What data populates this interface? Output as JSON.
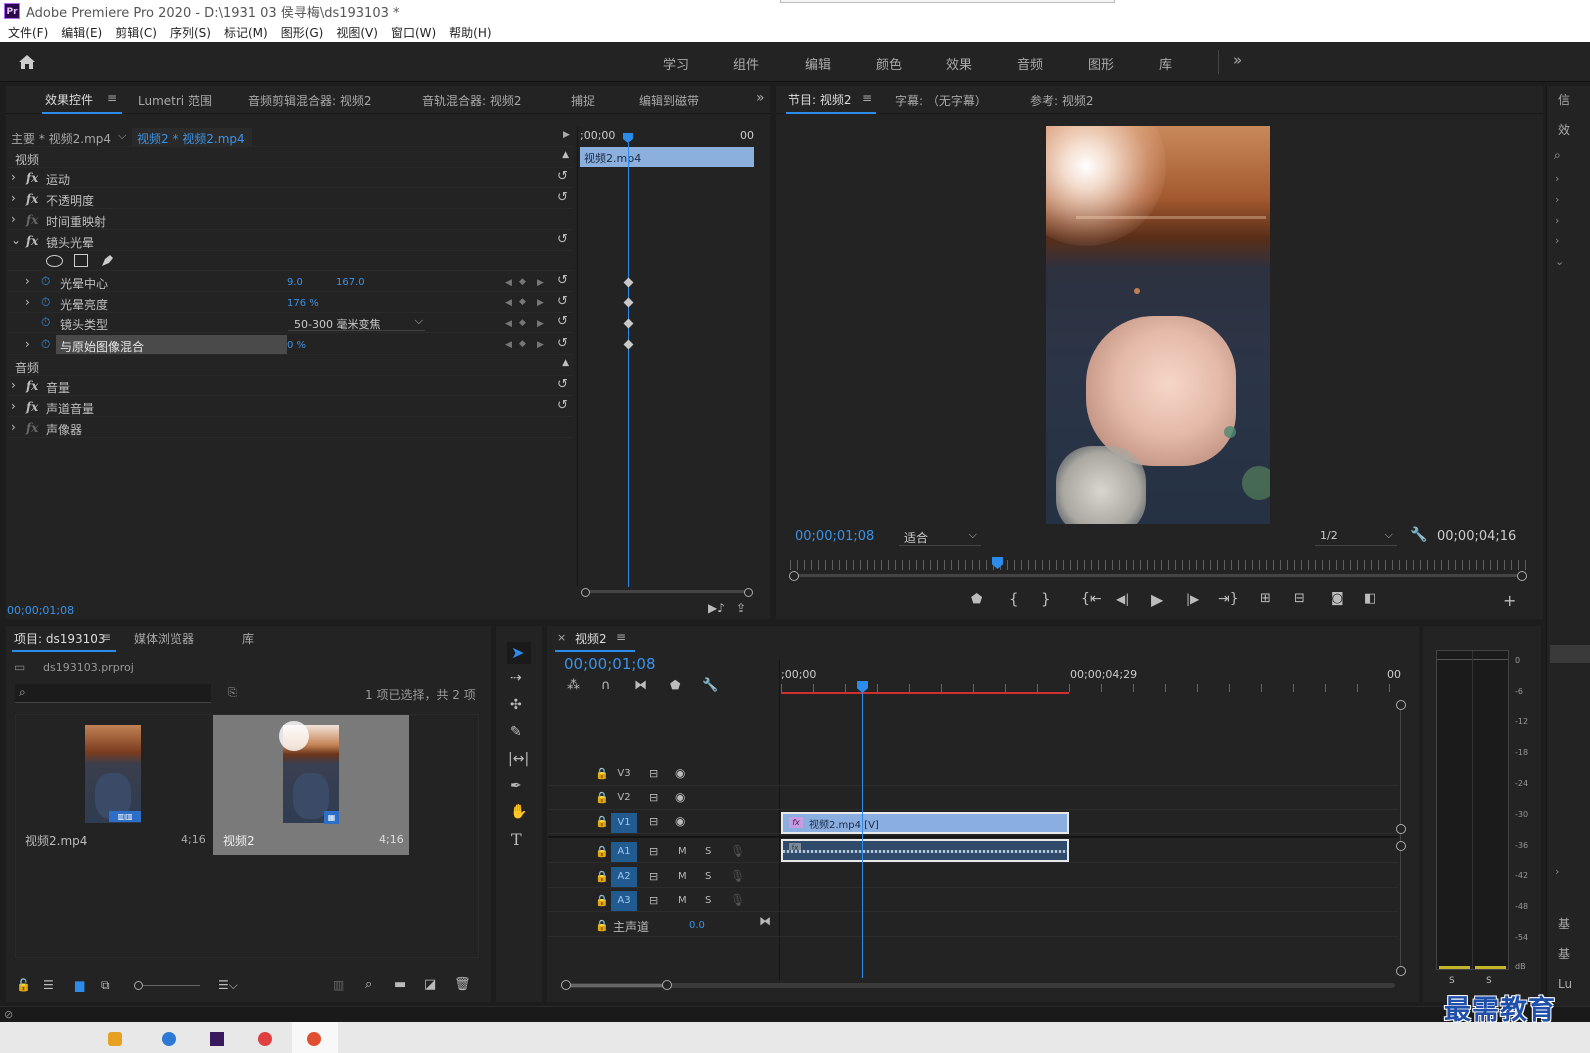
{
  "app": {
    "title": "Adobe Premiere Pro 2020 - D:\\1931 03 侯寻梅\\ds193103 *",
    "logo": "Pr"
  },
  "menu": [
    "文件(F)",
    "编辑(E)",
    "剪辑(C)",
    "序列(S)",
    "标记(M)",
    "图形(G)",
    "视图(V)",
    "窗口(W)",
    "帮助(H)"
  ],
  "workspaces": [
    "学习",
    "组件",
    "编辑",
    "颜色",
    "效果",
    "音频",
    "图形",
    "库"
  ],
  "workspace_more": "»",
  "upper_tabs": {
    "effect_controls": "效果控件",
    "lumetri": "Lumetri 范围",
    "clip_mixer": "音频剪辑混合器: 视频2",
    "track_mixer": "音轨混合器: 视频2",
    "capture": "捕捉",
    "edit_to_tape": "编辑到磁带",
    "more": "»"
  },
  "effect_controls": {
    "master": "主要 * 视频2.mp4",
    "sequence": "视频2 * 视频2.mp4",
    "mini_timeline_start": ";00;00",
    "mini_timeline_end": "00",
    "mini_clip": "视频2.mp4",
    "section_video": "视频",
    "section_audio": "音频",
    "fx_mark": "fx",
    "effects": {
      "motion": "运动",
      "opacity": "不透明度",
      "time_remap": "时间重映射",
      "lens_flare": "镜头光晕",
      "volume": "音量",
      "channel_volume": "声道音量",
      "panner": "声像器"
    },
    "params": {
      "flare_center": {
        "label": "光晕中心",
        "x": "9.0",
        "y": "167.0"
      },
      "flare_brightness": {
        "label": "光晕亮度",
        "value": "176 %"
      },
      "lens_type": {
        "label": "镜头类型",
        "value": "50-300 毫米变焦"
      },
      "blend": {
        "label": "与原始图像混合",
        "value": "0 %"
      }
    },
    "timecode": "00;00;01;08"
  },
  "program": {
    "tab": "节目: 视频2",
    "captions_tab": "字幕: （无字幕）",
    "reference_tab": "参考: 视频2",
    "timecode": "00;00;01;08",
    "fit": "适合",
    "resolution": "1/2",
    "duration": "00;00;04;16"
  },
  "project": {
    "tab": "项目: ds193103",
    "media_browser_tab": "媒体浏览器",
    "library_tab": "库",
    "file": "ds193103.prproj",
    "selection": "1 项已选择，共 2 项",
    "items": [
      {
        "name": "视频2.mp4",
        "duration": "4;16"
      },
      {
        "name": "视频2",
        "duration": "4;16"
      }
    ]
  },
  "timeline": {
    "tab": "视频2",
    "close": "×",
    "timecode": "00;00;01;08",
    "ruler_start": ";00;00",
    "ruler_mid": "00;00;04;29",
    "ruler_end": "00",
    "video_tracks": [
      "V3",
      "V2",
      "V1"
    ],
    "audio_tracks": [
      "A1",
      "A2",
      "A3"
    ],
    "mute": "M",
    "solo": "S",
    "master_label": "主声道",
    "master_value": "0.0",
    "clip_label": "视频2.mp4 [V]"
  },
  "meter": {
    "scale": [
      "0",
      "-6",
      "-12",
      "-18",
      "-24",
      "-30",
      "-36",
      "-42",
      "-48",
      "-54",
      "dB"
    ],
    "solo_left": "S",
    "solo_right": "S"
  },
  "right_edge": [
    "信",
    "效",
    "基",
    "基",
    "Lu"
  ],
  "watermark": "最需教育"
}
